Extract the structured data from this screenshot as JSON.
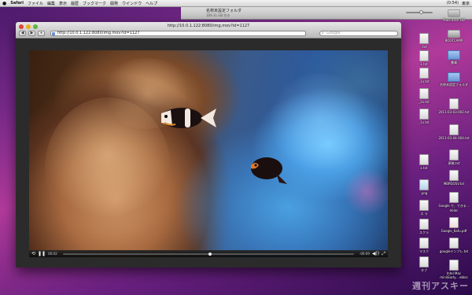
{
  "menubar": {
    "apple": "",
    "app": "Safari",
    "items": [
      "ファイル",
      "編集",
      "表示",
      "履歴",
      "ブックマーク",
      "開発",
      "ウインドウ",
      "ヘルプ"
    ],
    "right": [
      "(0:54)",
      "東京"
    ]
  },
  "folder_window": {
    "title": "名称未設定フォルダ",
    "subtitle": "169.31 GB 空き"
  },
  "safari": {
    "title": "http://10.0.1.122:8080/img.mov?id=1127",
    "url": "http://10.0.1.122:8080/img.mov?id=1127",
    "search_placeholder": "Google",
    "back": "◀",
    "forward": "▶",
    "add": "+",
    "reload": "↻"
  },
  "player": {
    "elapsed": "00:02",
    "remaining": "-00:09",
    "progress": 0.5
  },
  "desktop": {
    "icons": [
      {
        "label": "Macintosh HD",
        "kind": "drive"
      },
      {
        "label": "BOOTCAMP",
        "kind": "drive"
      },
      {
        "label": "書庫",
        "kind": "folder"
      },
      {
        "label": "名称未設定フォルダ",
        "kind": "folder"
      },
      {
        "label": "2011-03-03-002.txt",
        "kind": "doc"
      },
      {
        "label": "2011-03-04-004.txt",
        "kind": "doc"
      },
      {
        "label": "原稿.txt",
        "kind": "doc"
      },
      {
        "label": "MBPDOSV.txt",
        "kind": "doc"
      },
      {
        "label": "Google で、できる... ebloc",
        "kind": "doc"
      },
      {
        "label": "Google_Kafu.pdf",
        "kind": "pdf"
      },
      {
        "label": "googleテンプレ.txt",
        "kind": "doc"
      },
      {
        "label": "Intel Mac mini(Early... ebloc",
        "kind": "doc"
      }
    ],
    "left_icons": [
      {
        "label": ".txt"
      },
      {
        "label": "1.txt"
      },
      {
        "label": "_1x.txt"
      },
      {
        "label": "_2x.txt"
      },
      {
        "label": "_1x.txt"
      },
      {
        "label": "x.txt"
      },
      {
        "label": ".png"
      },
      {
        "label": "ス ラ",
        "kind": "doc"
      },
      {
        "label": "スクラ",
        "kind": "doc"
      },
      {
        "label": "マスク",
        "kind": "doc"
      },
      {
        "label": "タブ",
        "kind": "doc"
      }
    ]
  },
  "watermark": "週刊アスキー"
}
